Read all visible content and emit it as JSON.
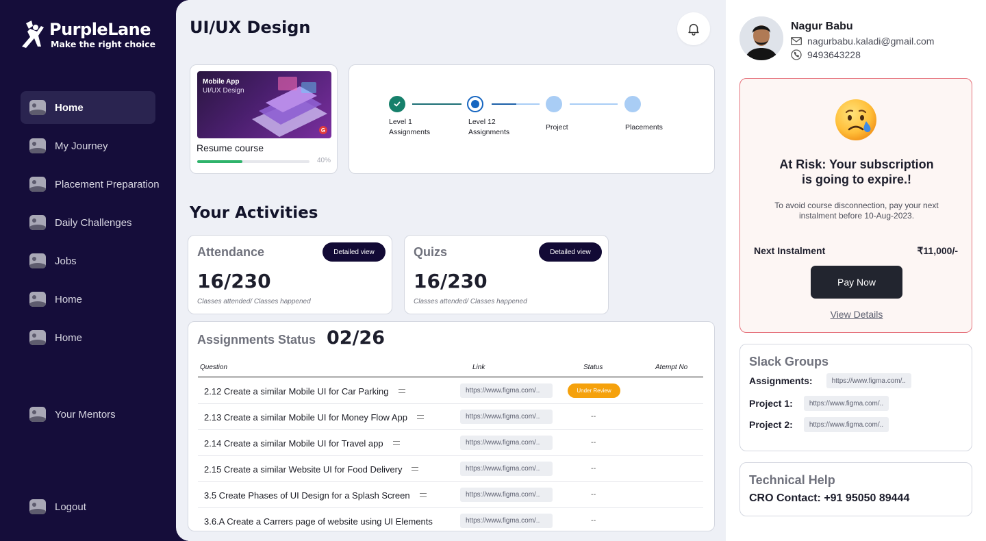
{
  "brand": {
    "name": "PurpleLane",
    "tagline": "Make the right choice"
  },
  "sidebar": {
    "items": [
      {
        "label": "Home",
        "active": true
      },
      {
        "label": "My Journey"
      },
      {
        "label": "Placement Preparation"
      },
      {
        "label": "Daily Challenges"
      },
      {
        "label": "Jobs"
      },
      {
        "label": "Home"
      },
      {
        "label": "Home"
      },
      {
        "label": "Your Mentors"
      },
      {
        "label": "Logout"
      }
    ]
  },
  "header": {
    "title": "UI/UX Design",
    "notification_icon": "bell-icon"
  },
  "course": {
    "thumb_line1": "Mobile App",
    "thumb_line2": "UI/UX Design",
    "badge": "G",
    "title": "Resume course",
    "progress_percent": 40,
    "progress_label": "40%"
  },
  "steps": [
    {
      "label_line1": "Level 1",
      "label_line2": "Assignments",
      "state": "done"
    },
    {
      "label_line1": "Level 12",
      "label_line2": "Assignments",
      "state": "current"
    },
    {
      "label_line1": "Project",
      "label_line2": "",
      "state": "upcoming"
    },
    {
      "label_line1": "Placements",
      "label_line2": "",
      "state": "upcoming"
    }
  ],
  "activities": {
    "title": "Your Activities",
    "attendance": {
      "title": "Attendance",
      "button": "Detailed view",
      "value": "16/230",
      "sub": "Classes attended/ Classes happened"
    },
    "quizs": {
      "title": "Quizs",
      "button": "Detailed view",
      "value": "16/230",
      "sub": "Classes attended/ Classes happened"
    }
  },
  "assignments": {
    "title": "Assignments Status",
    "count": "02/26",
    "headers": {
      "question": "Question",
      "link": "Link",
      "status": "Status",
      "attempt": "Atempt No"
    },
    "rows": [
      {
        "question": "2.12 Create a similar Mobile UI for Car Parking",
        "link": "https://www.figma.com/..",
        "status": "Under Review"
      },
      {
        "question": "2.13 Create a similar Mobile UI for Money Flow App",
        "link": "https://www.figma.com/..",
        "status": "--"
      },
      {
        "question": "2.14 Create a similar Mobile UI for Travel app",
        "link": "https://www.figma.com/..",
        "status": "--"
      },
      {
        "question": "2.15 Create a similar Website UI for Food Delivery",
        "link": "https://www.figma.com/..",
        "status": "--"
      },
      {
        "question": "3.5 Create Phases of UI Design for a Splash Screen",
        "link": "https://www.figma.com/..",
        "status": "--"
      },
      {
        "question": "3.6.A Create a Carrers page of website using UI Elements",
        "link": "https://www.figma.com/..",
        "status": "--"
      }
    ]
  },
  "user": {
    "name": "Nagur Babu",
    "email": "nagurbabu.kaladi@gmail.com",
    "phone": "9493643228"
  },
  "risk": {
    "title_line1": "At Risk: Your subscription",
    "title_line2": "is going to expire.!",
    "description": "To avoid course disconnection, pay your next instalment before 10-Aug-2023.",
    "instalment_label": "Next Instalment",
    "instalment_value": "₹11,000/-",
    "pay_button": "Pay Now",
    "view_details": "View Details"
  },
  "slack": {
    "title": "Slack Groups",
    "rows": [
      {
        "key": "Assignments:",
        "link": "https://www.figma.com/.."
      },
      {
        "key": "Project 1:",
        "link": "https://www.figma.com/.."
      },
      {
        "key": "Project 2:",
        "link": "https://www.figma.com/.."
      }
    ]
  },
  "help": {
    "title": "Technical Help",
    "contact": "CRO Contact: +91 95050 89444"
  },
  "colors": {
    "sidebar_bg": "#150d3a",
    "accent_dark": "#120a35",
    "progress_green": "#2fb36b",
    "step_done": "#16806b",
    "step_current": "#1565c0",
    "step_upcoming": "#a9cdf5",
    "status_orange": "#f5a10c",
    "risk_border": "#e5707a"
  }
}
